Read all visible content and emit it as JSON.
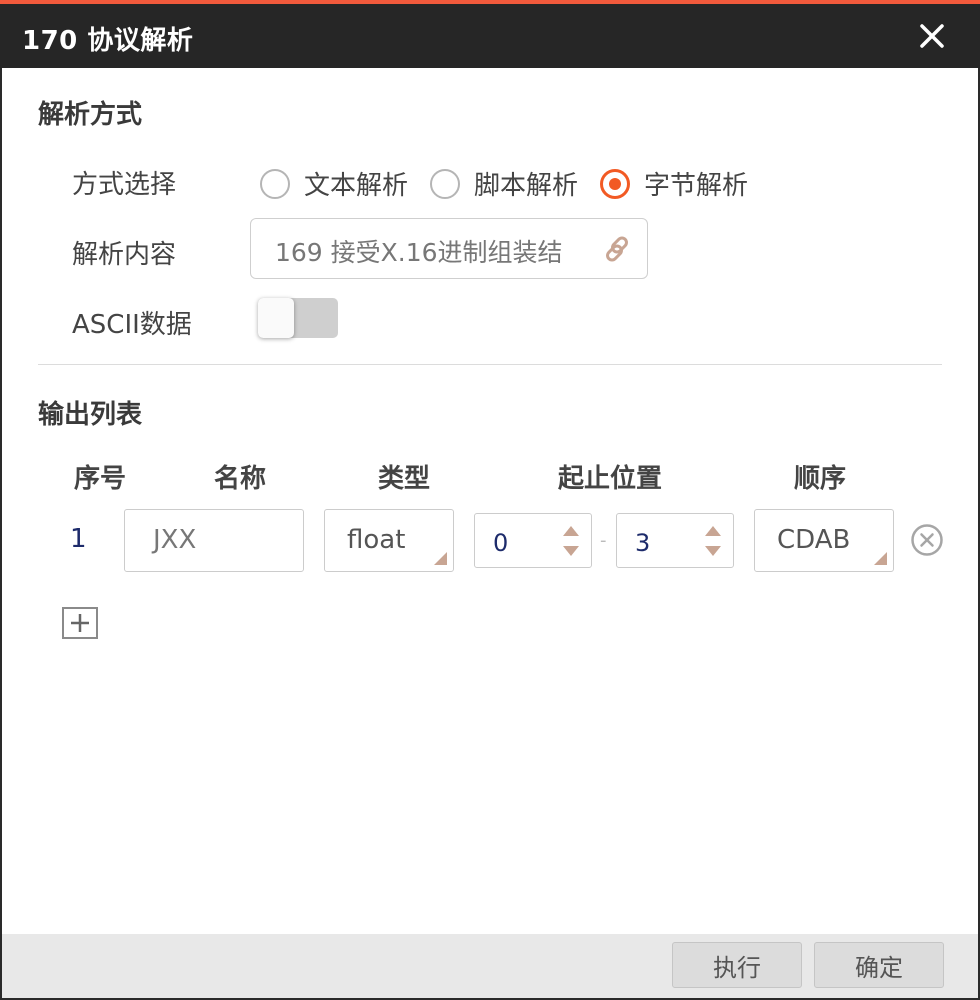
{
  "dialog": {
    "title": "170 协议解析"
  },
  "parse_section": {
    "title": "解析方式",
    "mode_label": "方式选择",
    "modes": [
      {
        "label": "文本解析",
        "selected": false
      },
      {
        "label": "脚本解析",
        "selected": false
      },
      {
        "label": "字节解析",
        "selected": true
      }
    ],
    "content_label": "解析内容",
    "content_value": "169 接受X.16进制组装结",
    "ascii_label": "ASCII数据",
    "ascii_enabled": false
  },
  "output_section": {
    "title": "输出列表",
    "columns": [
      "序号",
      "名称",
      "类型",
      "起止位置",
      "顺序"
    ],
    "rows": [
      {
        "index": "1",
        "name": "JXX",
        "type": "float",
        "start": "0",
        "end": "3",
        "order": "CDAB"
      }
    ]
  },
  "footer": {
    "execute_label": "执行",
    "confirm_label": "确定"
  },
  "colors": {
    "accent": "#f25a24",
    "titlebar": "#262626",
    "top_line": "#f25a3c"
  }
}
